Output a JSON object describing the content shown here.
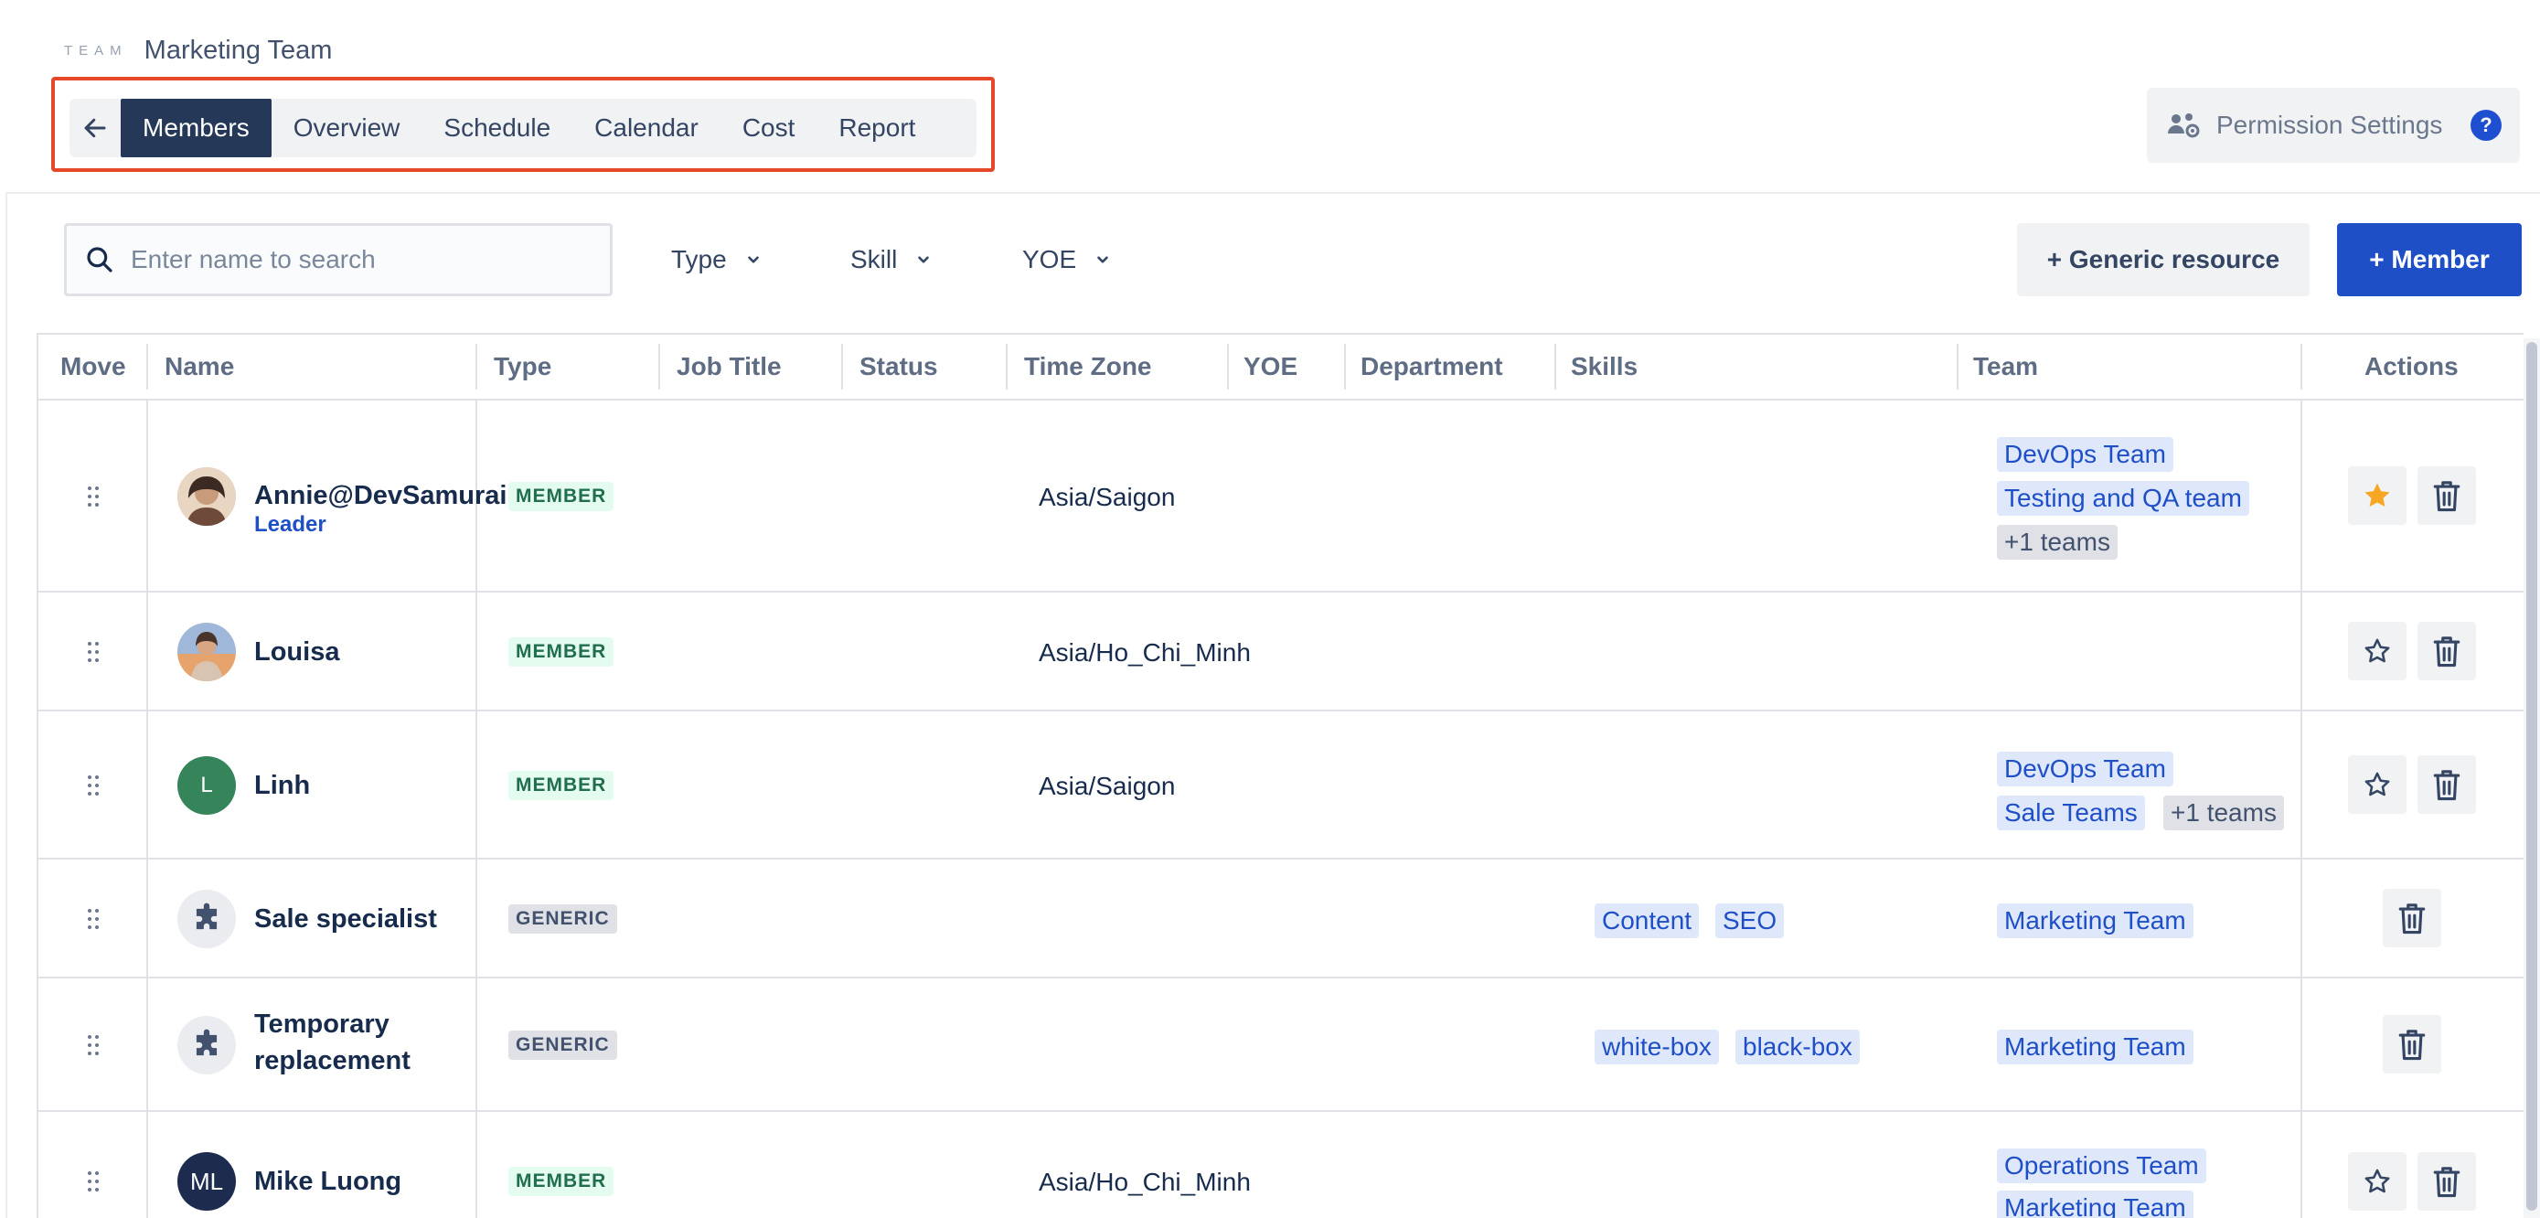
{
  "breadcrumb": {
    "label": "TEAM",
    "title": "Marketing Team"
  },
  "tabs": [
    "Members",
    "Overview",
    "Schedule",
    "Calendar",
    "Cost",
    "Report"
  ],
  "active_tab": "Members",
  "permission": {
    "label": "Permission Settings",
    "help": "?"
  },
  "search": {
    "placeholder": "Enter name to search"
  },
  "filters": [
    "Type",
    "Skill",
    "YOE"
  ],
  "buttons": {
    "generic": "+ Generic resource",
    "member": "+ Member"
  },
  "columns": [
    "Move",
    "Name",
    "Type",
    "Job Title",
    "Status",
    "Time Zone",
    "YOE",
    "Department",
    "Skills",
    "Team",
    "Actions"
  ],
  "rows": [
    {
      "name": "Annie@DevSamurai",
      "role": "Leader",
      "type": "MEMBER",
      "timezone": "Asia/Saigon",
      "skills": [],
      "teams": [
        "DevOps Team",
        "Testing and QA team"
      ],
      "more_teams": "+1 teams",
      "starred": true,
      "avatar": "photo"
    },
    {
      "name": "Louisa",
      "role": "",
      "type": "MEMBER",
      "timezone": "Asia/Ho_Chi_Minh",
      "skills": [],
      "teams": [],
      "more_teams": "",
      "starred": false,
      "avatar": "photo"
    },
    {
      "name": "Linh",
      "role": "",
      "type": "MEMBER",
      "timezone": "Asia/Saigon",
      "skills": [],
      "teams": [
        "DevOps Team",
        "Sale Teams"
      ],
      "more_teams": "+1 teams",
      "starred": false,
      "avatar": "L"
    },
    {
      "name": "Sale specialist",
      "role": "",
      "type": "GENERIC",
      "timezone": "",
      "skills": [
        "Content",
        "SEO"
      ],
      "teams": [
        "Marketing Team"
      ],
      "more_teams": "",
      "starred": null,
      "avatar": "puzzle"
    },
    {
      "name_lines": [
        "Temporary",
        "replacement"
      ],
      "role": "",
      "type": "GENERIC",
      "timezone": "",
      "skills": [
        "white-box",
        "black-box"
      ],
      "teams": [
        "Marketing Team"
      ],
      "more_teams": "",
      "starred": null,
      "avatar": "puzzle"
    },
    {
      "name": "Mike Luong",
      "role": "",
      "type": "MEMBER",
      "timezone": "Asia/Ho_Chi_Minh",
      "skills": [],
      "teams": [
        "Operations Team",
        "Marketing Team"
      ],
      "more_teams": "",
      "starred": false,
      "avatar": "ML"
    }
  ],
  "colors": {
    "active_tab": "#253858",
    "primary": "#1f4fc7",
    "highlight_border": "#e5472a",
    "star": "#f6a623",
    "linh_avatar": "#36855a",
    "ml_avatar": "#1d2b4f"
  }
}
